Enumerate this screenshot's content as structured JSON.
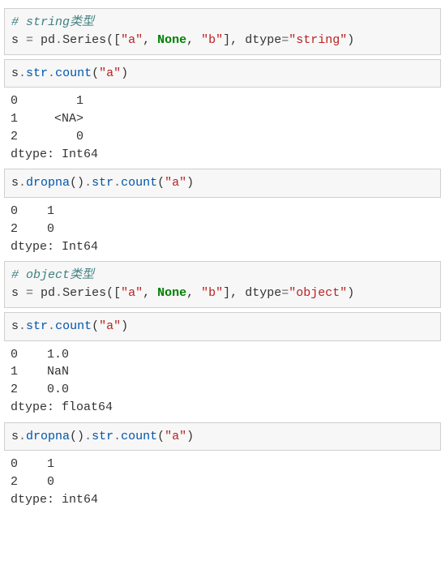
{
  "cells": [
    {
      "id": "c1",
      "comment_t": "# ",
      "comment_kw": "string",
      "comment_rest": "类型",
      "line2": {
        "s": "s",
        "eq": " = ",
        "pd": "pd",
        "dot1": ".",
        "series": "Series",
        "lp": "([",
        "a": "\"a\"",
        "comma1": ", ",
        "none": "None",
        "comma2": ", ",
        "b": "\"b\"",
        "rp": "], ",
        "dtype": "dtype",
        "eq2": "=",
        "dval": "\"string\"",
        "close": ")"
      }
    },
    {
      "id": "c2",
      "line": {
        "s": "s",
        "dot1": ".",
        "str": "str",
        "dot2": ".",
        "count": "count",
        "lp": "(",
        "a": "\"a\"",
        "rp": ")"
      }
    },
    {
      "id": "o1",
      "text": "0        1\n1     <NA>\n2        0\ndtype: Int64"
    },
    {
      "id": "c3",
      "line": {
        "s": "s",
        "dot1": ".",
        "dropna": "dropna",
        "p1": "()",
        "dot2": ".",
        "str": "str",
        "dot3": ".",
        "count": "count",
        "lp": "(",
        "a": "\"a\"",
        "rp": ")"
      }
    },
    {
      "id": "o2",
      "text": "0    1\n2    0\ndtype: Int64"
    },
    {
      "id": "c4",
      "comment_t": "# ",
      "comment_kw": "object",
      "comment_rest": "类型",
      "line2": {
        "s": "s",
        "eq": " = ",
        "pd": "pd",
        "dot1": ".",
        "series": "Series",
        "lp": "([",
        "a": "\"a\"",
        "comma1": ", ",
        "none": "None",
        "comma2": ", ",
        "b": "\"b\"",
        "rp": "], ",
        "dtype": "dtype",
        "eq2": "=",
        "dval": "\"object\"",
        "close": ")"
      }
    },
    {
      "id": "c5",
      "line": {
        "s": "s",
        "dot1": ".",
        "str": "str",
        "dot2": ".",
        "count": "count",
        "lp": "(",
        "a": "\"a\"",
        "rp": ")"
      }
    },
    {
      "id": "o3",
      "text": "0    1.0\n1    NaN\n2    0.0\ndtype: float64"
    },
    {
      "id": "c6",
      "line": {
        "s": "s",
        "dot1": ".",
        "dropna": "dropna",
        "p1": "()",
        "dot2": ".",
        "str": "str",
        "dot3": ".",
        "count": "count",
        "lp": "(",
        "a": "\"a\"",
        "rp": ")"
      }
    },
    {
      "id": "o4",
      "text": "0    1\n2    0\ndtype: int64"
    }
  ]
}
